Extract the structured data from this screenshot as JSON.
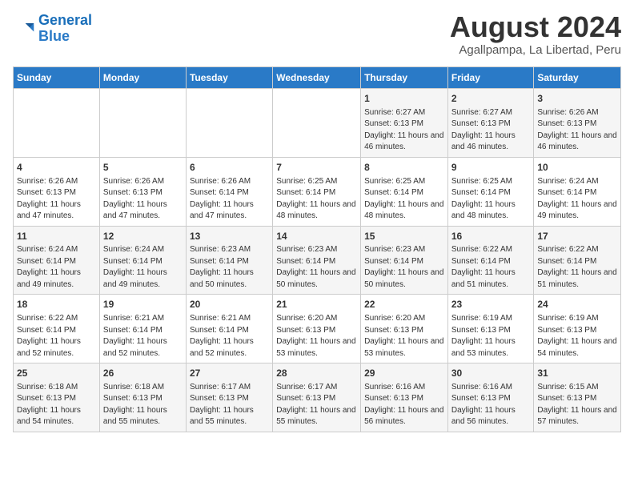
{
  "logo": {
    "line1": "General",
    "line2": "Blue"
  },
  "title": "August 2024",
  "subtitle": "Agallpampa, La Libertad, Peru",
  "weekdays": [
    "Sunday",
    "Monday",
    "Tuesday",
    "Wednesday",
    "Thursday",
    "Friday",
    "Saturday"
  ],
  "weeks": [
    [
      {
        "day": "",
        "info": ""
      },
      {
        "day": "",
        "info": ""
      },
      {
        "day": "",
        "info": ""
      },
      {
        "day": "",
        "info": ""
      },
      {
        "day": "1",
        "info": "Sunrise: 6:27 AM\nSunset: 6:13 PM\nDaylight: 11 hours and 46 minutes."
      },
      {
        "day": "2",
        "info": "Sunrise: 6:27 AM\nSunset: 6:13 PM\nDaylight: 11 hours and 46 minutes."
      },
      {
        "day": "3",
        "info": "Sunrise: 6:26 AM\nSunset: 6:13 PM\nDaylight: 11 hours and 46 minutes."
      }
    ],
    [
      {
        "day": "4",
        "info": "Sunrise: 6:26 AM\nSunset: 6:13 PM\nDaylight: 11 hours and 47 minutes."
      },
      {
        "day": "5",
        "info": "Sunrise: 6:26 AM\nSunset: 6:13 PM\nDaylight: 11 hours and 47 minutes."
      },
      {
        "day": "6",
        "info": "Sunrise: 6:26 AM\nSunset: 6:14 PM\nDaylight: 11 hours and 47 minutes."
      },
      {
        "day": "7",
        "info": "Sunrise: 6:25 AM\nSunset: 6:14 PM\nDaylight: 11 hours and 48 minutes."
      },
      {
        "day": "8",
        "info": "Sunrise: 6:25 AM\nSunset: 6:14 PM\nDaylight: 11 hours and 48 minutes."
      },
      {
        "day": "9",
        "info": "Sunrise: 6:25 AM\nSunset: 6:14 PM\nDaylight: 11 hours and 48 minutes."
      },
      {
        "day": "10",
        "info": "Sunrise: 6:24 AM\nSunset: 6:14 PM\nDaylight: 11 hours and 49 minutes."
      }
    ],
    [
      {
        "day": "11",
        "info": "Sunrise: 6:24 AM\nSunset: 6:14 PM\nDaylight: 11 hours and 49 minutes."
      },
      {
        "day": "12",
        "info": "Sunrise: 6:24 AM\nSunset: 6:14 PM\nDaylight: 11 hours and 49 minutes."
      },
      {
        "day": "13",
        "info": "Sunrise: 6:23 AM\nSunset: 6:14 PM\nDaylight: 11 hours and 50 minutes."
      },
      {
        "day": "14",
        "info": "Sunrise: 6:23 AM\nSunset: 6:14 PM\nDaylight: 11 hours and 50 minutes."
      },
      {
        "day": "15",
        "info": "Sunrise: 6:23 AM\nSunset: 6:14 PM\nDaylight: 11 hours and 50 minutes."
      },
      {
        "day": "16",
        "info": "Sunrise: 6:22 AM\nSunset: 6:14 PM\nDaylight: 11 hours and 51 minutes."
      },
      {
        "day": "17",
        "info": "Sunrise: 6:22 AM\nSunset: 6:14 PM\nDaylight: 11 hours and 51 minutes."
      }
    ],
    [
      {
        "day": "18",
        "info": "Sunrise: 6:22 AM\nSunset: 6:14 PM\nDaylight: 11 hours and 52 minutes."
      },
      {
        "day": "19",
        "info": "Sunrise: 6:21 AM\nSunset: 6:14 PM\nDaylight: 11 hours and 52 minutes."
      },
      {
        "day": "20",
        "info": "Sunrise: 6:21 AM\nSunset: 6:14 PM\nDaylight: 11 hours and 52 minutes."
      },
      {
        "day": "21",
        "info": "Sunrise: 6:20 AM\nSunset: 6:13 PM\nDaylight: 11 hours and 53 minutes."
      },
      {
        "day": "22",
        "info": "Sunrise: 6:20 AM\nSunset: 6:13 PM\nDaylight: 11 hours and 53 minutes."
      },
      {
        "day": "23",
        "info": "Sunrise: 6:19 AM\nSunset: 6:13 PM\nDaylight: 11 hours and 53 minutes."
      },
      {
        "day": "24",
        "info": "Sunrise: 6:19 AM\nSunset: 6:13 PM\nDaylight: 11 hours and 54 minutes."
      }
    ],
    [
      {
        "day": "25",
        "info": "Sunrise: 6:18 AM\nSunset: 6:13 PM\nDaylight: 11 hours and 54 minutes."
      },
      {
        "day": "26",
        "info": "Sunrise: 6:18 AM\nSunset: 6:13 PM\nDaylight: 11 hours and 55 minutes."
      },
      {
        "day": "27",
        "info": "Sunrise: 6:17 AM\nSunset: 6:13 PM\nDaylight: 11 hours and 55 minutes."
      },
      {
        "day": "28",
        "info": "Sunrise: 6:17 AM\nSunset: 6:13 PM\nDaylight: 11 hours and 55 minutes."
      },
      {
        "day": "29",
        "info": "Sunrise: 6:16 AM\nSunset: 6:13 PM\nDaylight: 11 hours and 56 minutes."
      },
      {
        "day": "30",
        "info": "Sunrise: 6:16 AM\nSunset: 6:13 PM\nDaylight: 11 hours and 56 minutes."
      },
      {
        "day": "31",
        "info": "Sunrise: 6:15 AM\nSunset: 6:13 PM\nDaylight: 11 hours and 57 minutes."
      }
    ]
  ]
}
